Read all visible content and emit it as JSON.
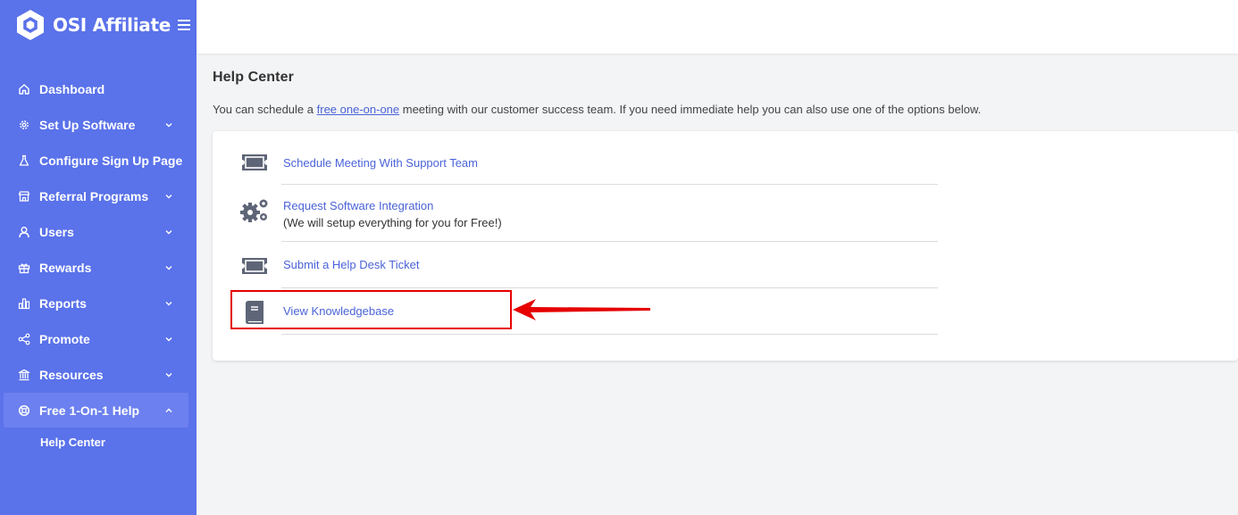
{
  "brand": {
    "name": "OSI Affiliate",
    "logo_icon": "hexagon-logo-icon"
  },
  "sidebar": {
    "items": [
      {
        "label": "Dashboard",
        "icon": "home-icon",
        "has_chevron": false
      },
      {
        "label": "Set Up Software",
        "icon": "gear-icon",
        "has_chevron": true
      },
      {
        "label": "Configure Sign Up Page",
        "icon": "flask-icon",
        "has_chevron": false
      },
      {
        "label": "Referral Programs",
        "icon": "store-icon",
        "has_chevron": true
      },
      {
        "label": "Users",
        "icon": "user-icon",
        "has_chevron": true
      },
      {
        "label": "Rewards",
        "icon": "gift-icon",
        "has_chevron": true
      },
      {
        "label": "Reports",
        "icon": "bar-chart-icon",
        "has_chevron": true
      },
      {
        "label": "Promote",
        "icon": "share-icon",
        "has_chevron": true
      },
      {
        "label": "Resources",
        "icon": "bank-icon",
        "has_chevron": true
      },
      {
        "label": "Free 1-On-1 Help",
        "icon": "lifebuoy-icon",
        "has_chevron": true,
        "active": true
      }
    ],
    "sub_items": [
      {
        "label": "Help Center"
      }
    ]
  },
  "main": {
    "title": "Help Center",
    "intro_before": "You can schedule a ",
    "intro_link": "free one-on-one",
    "intro_after": " meeting with our customer success team. If you need immediate help you can also use one of the options below.",
    "options": [
      {
        "label": "Schedule Meeting With Support Team",
        "icon": "ticket-icon"
      },
      {
        "label": "Request Software Integration",
        "sub": "(We will setup everything for you for Free!)",
        "icon": "gears-icon"
      },
      {
        "label": "Submit a Help Desk Ticket",
        "icon": "ticket-icon"
      },
      {
        "label": "View Knowledgebase",
        "icon": "book-icon"
      }
    ]
  },
  "colors": {
    "sidebar_bg": "#5a72ea",
    "link": "#4a63d8",
    "highlight": "#e60000"
  }
}
